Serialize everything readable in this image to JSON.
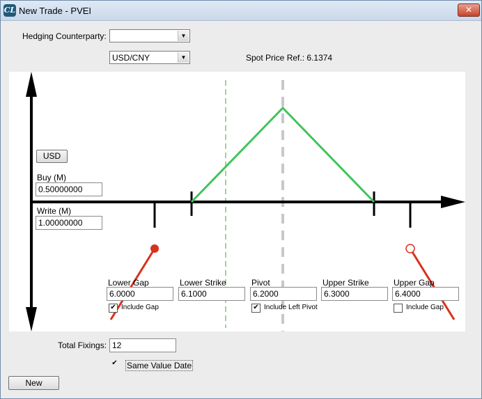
{
  "window": {
    "title": "New Trade - PVEI",
    "app_icon": "CL",
    "close_label": "✕"
  },
  "form": {
    "hedging_label": "Hedging Counterparty:",
    "hedging_value": "",
    "currency_pair": "USD/CNY",
    "spot_label": "Spot Price Ref.:",
    "spot_value": "6.1374"
  },
  "chart_panel": {
    "currency_button": "USD",
    "buy_label": "Buy (M)",
    "buy_value": "0.50000000",
    "write_label": "Write (M)",
    "write_value": "1.00000000"
  },
  "strikes": [
    {
      "label": "Lower Gap",
      "value": "6.0000",
      "checkbox_label": "Include Gap",
      "checked": true
    },
    {
      "label": "Lower Strike",
      "value": "6.1000"
    },
    {
      "label": "Pivot",
      "value": "6.2000",
      "checkbox_label": "Include Left Pivot",
      "checked": true
    },
    {
      "label": "Upper Strike",
      "value": "6.3000"
    },
    {
      "label": "Upper Gap",
      "value": "6.4000",
      "checkbox_label": "Include Gap",
      "checked": false
    }
  ],
  "footer": {
    "fixings_label": "Total Fixings:",
    "fixings_value": "12",
    "same_value_date_label": "Same Value Date",
    "same_value_date_checked": true,
    "new_button": "New"
  },
  "colors": {
    "payoff_line": "#3fc45a",
    "gap_marker": "#d9311c",
    "spot_line": "#3aa83a",
    "pivot_line": "#c0c0c0"
  }
}
